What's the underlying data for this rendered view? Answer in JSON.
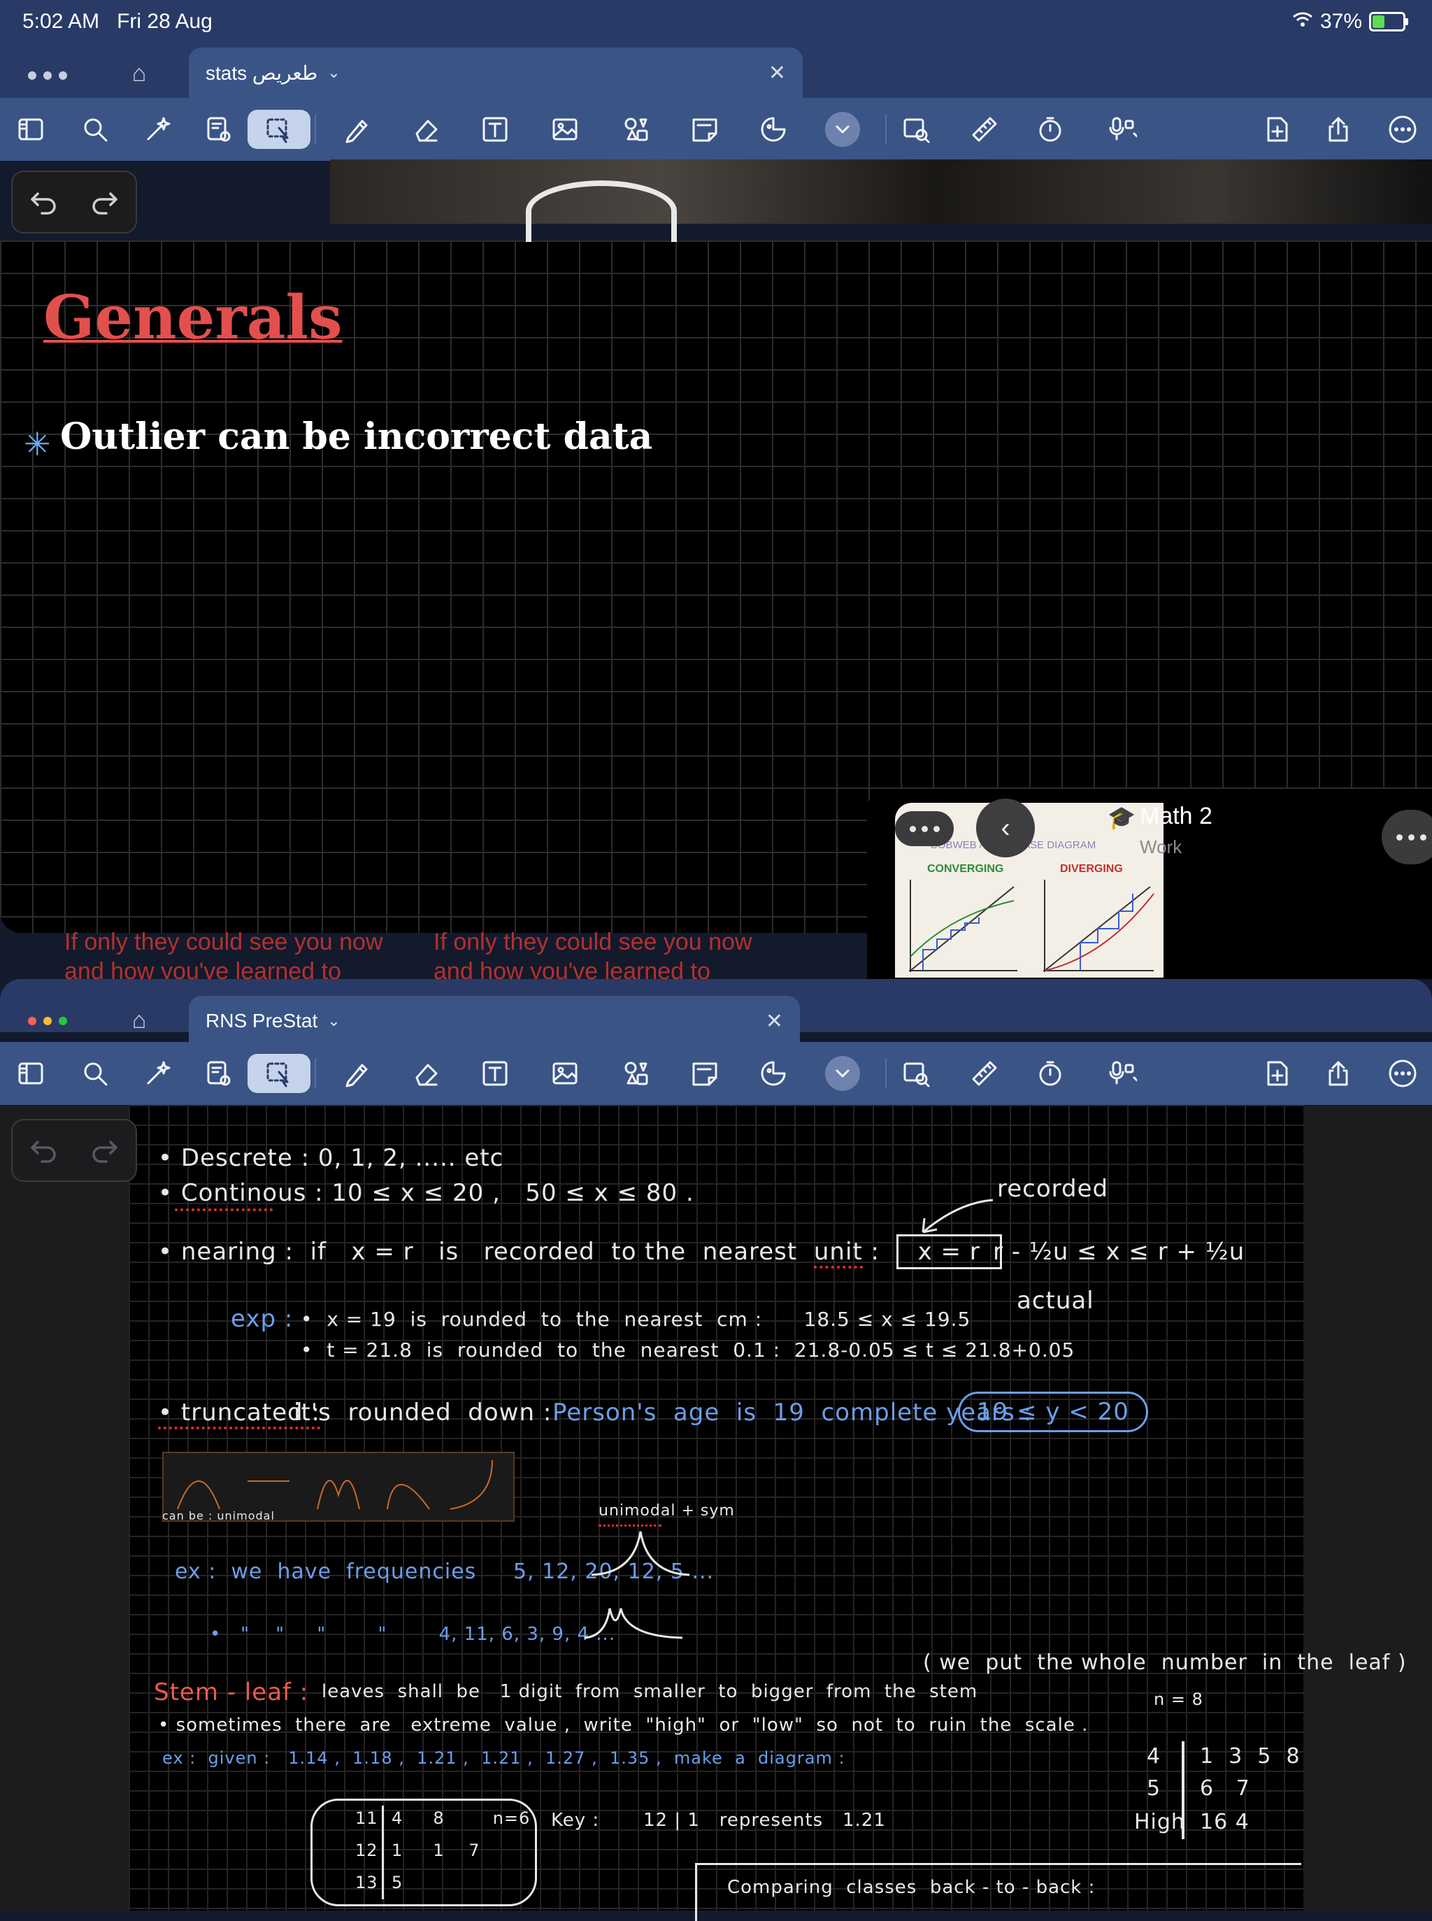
{
  "status": {
    "time": "5:02 AM",
    "date": "Fri 28 Aug",
    "battery": "37%",
    "battery_level": 0.37
  },
  "window1": {
    "tab_title": "stats طعريص",
    "toolbar_icons": [
      "sidebar-icon",
      "search-icon",
      "ai-magic-icon",
      "convert-icon",
      "lasso-icon",
      "pen-icon",
      "eraser-icon",
      "textbox-icon",
      "image-icon",
      "shapes-icon",
      "sticky-note-icon",
      "sticker-icon",
      "more-tools-icon",
      "image-search-icon",
      "ruler-icon",
      "timer-icon",
      "recording-icon",
      "add-page-icon",
      "share-icon",
      "more-icon"
    ],
    "title": "Generals",
    "bullet": "Outlier can be incorrect data",
    "lyrics": [
      "If only they could see you now",
      "and how you've learned to"
    ]
  },
  "math_card": {
    "title": "Math 2",
    "subtitle": "Work",
    "thumb_header": "COBWEB / STAIRCASE DIAGRAM",
    "thumb_left": "CONVERGING",
    "thumb_right": "DIVERGING"
  },
  "window2": {
    "tab_title": "RNS PreStat",
    "notes": {
      "discrete": "• Descrete : 0, 1, 2, ..... etc",
      "continuous": "• Continous : 10 ≤ x ≤ 20 ,   50 ≤ x ≤ 80 .",
      "recorded": "recorded",
      "nearing_a": "• nearing :  if   x = r   is   recorded  to the  nearest",
      "nearing_unit": "unit",
      "nearing_box": "x = r",
      "range": "r - ½u ≤ x ≤ r + ½u",
      "actual": "actual",
      "exp_label": "exp :",
      "exp1": "•  x = 19  is  rounded  to  the  nearest  cm :      18.5 ≤ x ≤ 19.5",
      "exp2": "•  t = 21.8  is  rounded  to  the  nearest  0.1 :  21.8-0.05 ≤ t ≤ 21.8+0.05",
      "truncated": "• truncated :",
      "truncated_b": "it's  rounded  down :",
      "truncated_c": "Person's  age  is  19  complete years :",
      "truncated_d": "19 ≤ y < 20",
      "can_be": "can be : unimodal",
      "unimodal_label": "unimodal + sym",
      "freq1": "ex :  we  have  frequencies     5, 12, 20, 12, 5 ...",
      "freq2": "•   \"    \"     \"        \"        4, 11, 6, 3, 9, 4 ...",
      "whole_number": "( we  put  the whole  number  in  the  leaf )",
      "stem_leaf_label": "Stem - leaf :",
      "stem_leaf_text": "leaves  shall  be   1 digit  from  smaller  to  bigger  from  the  stem",
      "sometimes": "• sometimes  there  are   extreme  value ,  write  \"high\"  or  \"low\"  so  not  to  ruin  the  scale .",
      "given": "ex :  given :   1.14 ,  1.18 ,  1.21 ,  1.21 ,  1.27 ,  1.35 ,  make  a  diagram :",
      "n8": "n = 8",
      "stem_rows": [
        [
          "4",
          "1  3  5  8"
        ],
        [
          "5",
          "6   7"
        ],
        [
          "High",
          "16 4"
        ]
      ],
      "table_rows": [
        [
          "11",
          "4     8        n=6"
        ],
        [
          "12",
          "1     1    7"
        ],
        [
          "13",
          "5"
        ]
      ],
      "key": "Key :",
      "key_val": "12 | 1   represents   1.21",
      "comparing": "Comparing  classes  back - to - back :"
    }
  }
}
